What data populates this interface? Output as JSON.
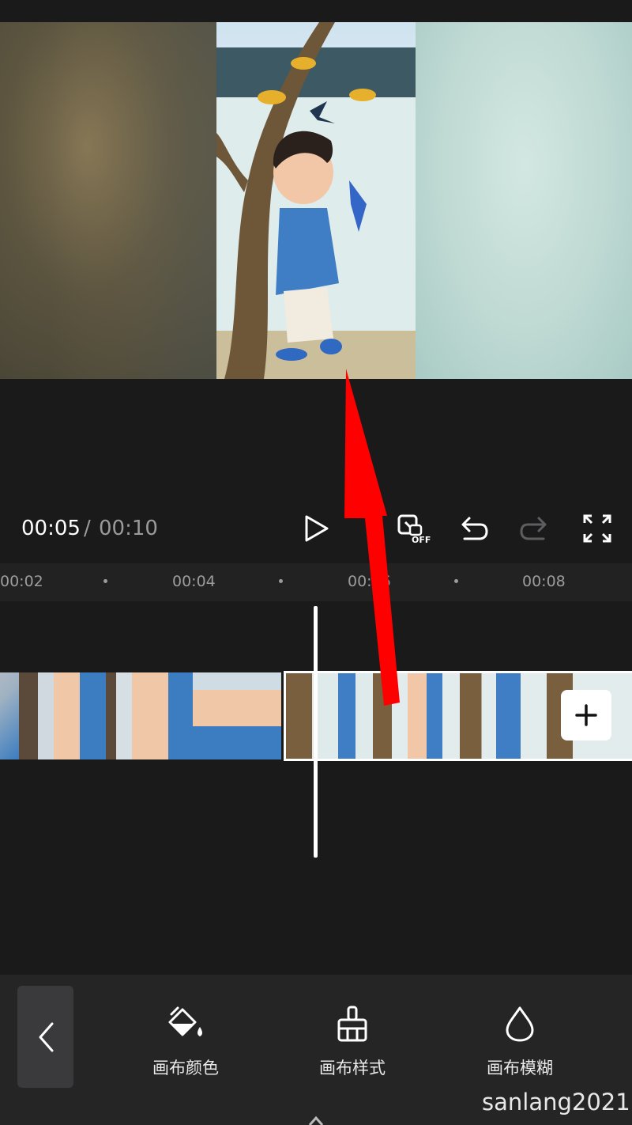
{
  "player": {
    "current_time": "00:05",
    "separator": "/",
    "total_time": "00:10"
  },
  "ruler": {
    "ticks": [
      "00:02",
      "00:04",
      "00:06",
      "00:08"
    ]
  },
  "toolbar": {
    "items": [
      {
        "label": "画布颜色",
        "icon": "paint-bucket-icon"
      },
      {
        "label": "画布样式",
        "icon": "brush-icon"
      },
      {
        "label": "画布模糊",
        "icon": "drop-icon"
      }
    ]
  },
  "watermark": "sanlang2021",
  "colors": {
    "background": "#1a1a1b",
    "annotation_arrow": "#ff0000",
    "toolbar": "#252526"
  }
}
